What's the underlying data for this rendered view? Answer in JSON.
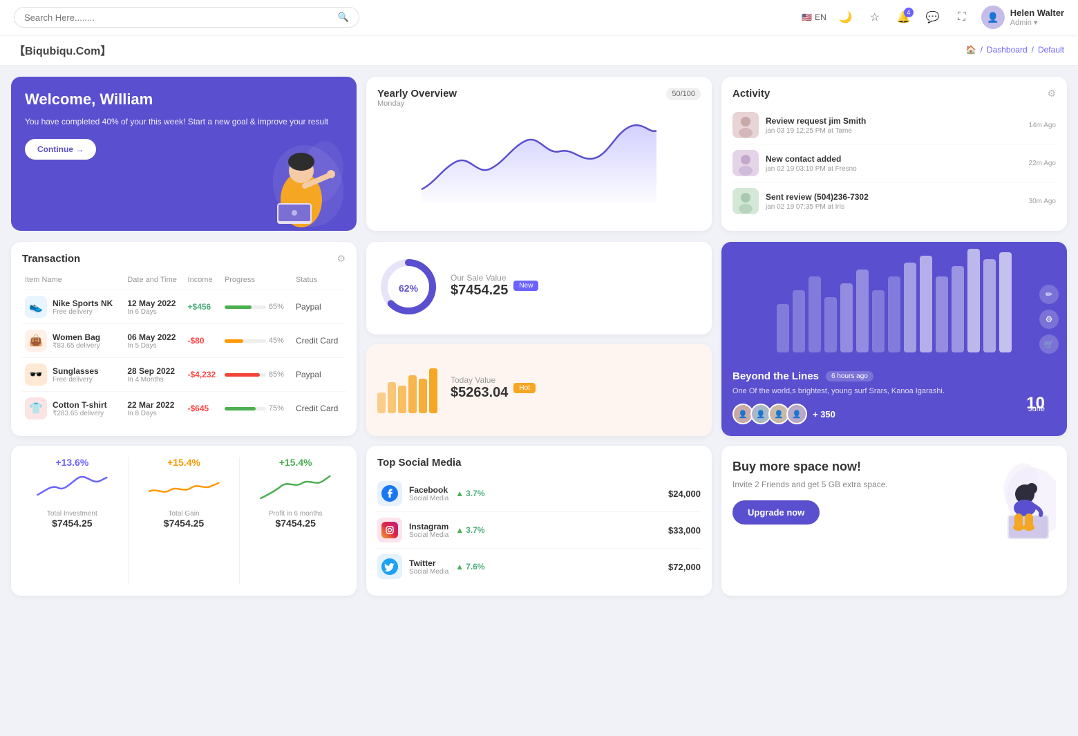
{
  "topnav": {
    "search_placeholder": "Search Here........",
    "lang": "EN",
    "notification_count": "4",
    "user": {
      "name": "Helen Walter",
      "role": "Admin"
    }
  },
  "breadcrumb": {
    "brand": "【Biqubiqu.Com】",
    "home": "🏠",
    "path": [
      "Dashboard",
      "Default"
    ]
  },
  "welcome": {
    "title": "Welcome, William",
    "desc": "You have completed 40% of your this week! Start a new goal & improve your result",
    "btn": "Continue →"
  },
  "yearly": {
    "title": "Yearly Overview",
    "sub": "Monday",
    "badge": "50/100"
  },
  "activity": {
    "title": "Activity",
    "items": [
      {
        "title": "Review request jim Smith",
        "sub": "jan 03 19 12:25 PM at Tame",
        "time": "14m Ago",
        "color": "#e8d4d4"
      },
      {
        "title": "New contact added",
        "sub": "jan 02 19 03:10 PM at Fresno",
        "time": "22m Ago",
        "color": "#e4d4e8"
      },
      {
        "title": "Sent review (504)236-7302",
        "sub": "jan 02 19 07:35 PM at Iris",
        "time": "30m Ago",
        "color": "#d4e8d8"
      }
    ]
  },
  "transaction": {
    "title": "Transaction",
    "cols": [
      "Item Name",
      "Date and Time",
      "Income",
      "Progress",
      "Status"
    ],
    "rows": [
      {
        "icon": "👟",
        "icon_bg": "#e8f4ff",
        "name": "Nike Sports NK",
        "sub": "Free delivery",
        "date": "12 May 2022",
        "days": "In 6 Days",
        "income": "+$456",
        "pos": true,
        "progress": 65,
        "prog_color": "#4caf50",
        "status": "Paypal"
      },
      {
        "icon": "👜",
        "icon_bg": "#fff0e8",
        "name": "Women Bag",
        "sub": "₹83.65 delivery",
        "date": "06 May 2022",
        "days": "In 5 Days",
        "income": "-$80",
        "pos": false,
        "progress": 45,
        "prog_color": "#ff9800",
        "status": "Credit Card"
      },
      {
        "icon": "🕶️",
        "icon_bg": "#ffe8d4",
        "name": "Sunglasses",
        "sub": "Free delivery",
        "date": "28 Sep 2022",
        "days": "In 4 Months",
        "income": "-$4,232",
        "pos": false,
        "progress": 85,
        "prog_color": "#f44336",
        "status": "Paypal"
      },
      {
        "icon": "👕",
        "icon_bg": "#fce4e4",
        "name": "Cotton T-shirt",
        "sub": "₹283.65 delivery",
        "date": "22 Mar 2022",
        "days": "In 8 Days",
        "income": "-$645",
        "pos": false,
        "progress": 75,
        "prog_color": "#4caf50",
        "status": "Credit Card"
      }
    ]
  },
  "sale": {
    "badge": "New",
    "percent": "62%",
    "label": "Our Sale Value",
    "value": "$7454.25"
  },
  "today": {
    "badge": "Hot",
    "label": "Today Value",
    "value": "$5263.04"
  },
  "beyondlines": {
    "title": "Beyond the Lines",
    "time": "6 hours ago",
    "desc": "One Of the world,s brightest, young surf Srars, Kanoa Igarashi.",
    "count": "+ 350",
    "date_day": "10",
    "date_month": "June"
  },
  "stats": [
    {
      "pct": "+13.6%",
      "color": "#6c63ff",
      "label": "Total Investment",
      "val": "$7454.25"
    },
    {
      "pct": "+15.4%",
      "color": "#ff9800",
      "label": "Total Gain",
      "val": "$7454.25"
    },
    {
      "pct": "+15.4%",
      "color": "#4caf50",
      "label": "Profit in 6 months",
      "val": "$7454.25"
    }
  ],
  "social": {
    "title": "Top Social Media",
    "items": [
      {
        "name": "Facebook",
        "type": "Social Media",
        "pct": "3.7%",
        "val": "$24,000",
        "color": "#1877f2",
        "icon": "f"
      },
      {
        "name": "Instagram",
        "type": "Social Media",
        "pct": "3.7%",
        "val": "$33,000",
        "color": "#e1306c",
        "icon": "📷"
      },
      {
        "name": "Twitter",
        "type": "Social Media",
        "pct": "7.6%",
        "val": "$72,000",
        "color": "#1da1f2",
        "icon": "t"
      }
    ]
  },
  "space": {
    "title": "Buy more space now!",
    "desc": "Invite 2 Friends and get 5 GB extra space.",
    "btn": "Upgrade now"
  }
}
